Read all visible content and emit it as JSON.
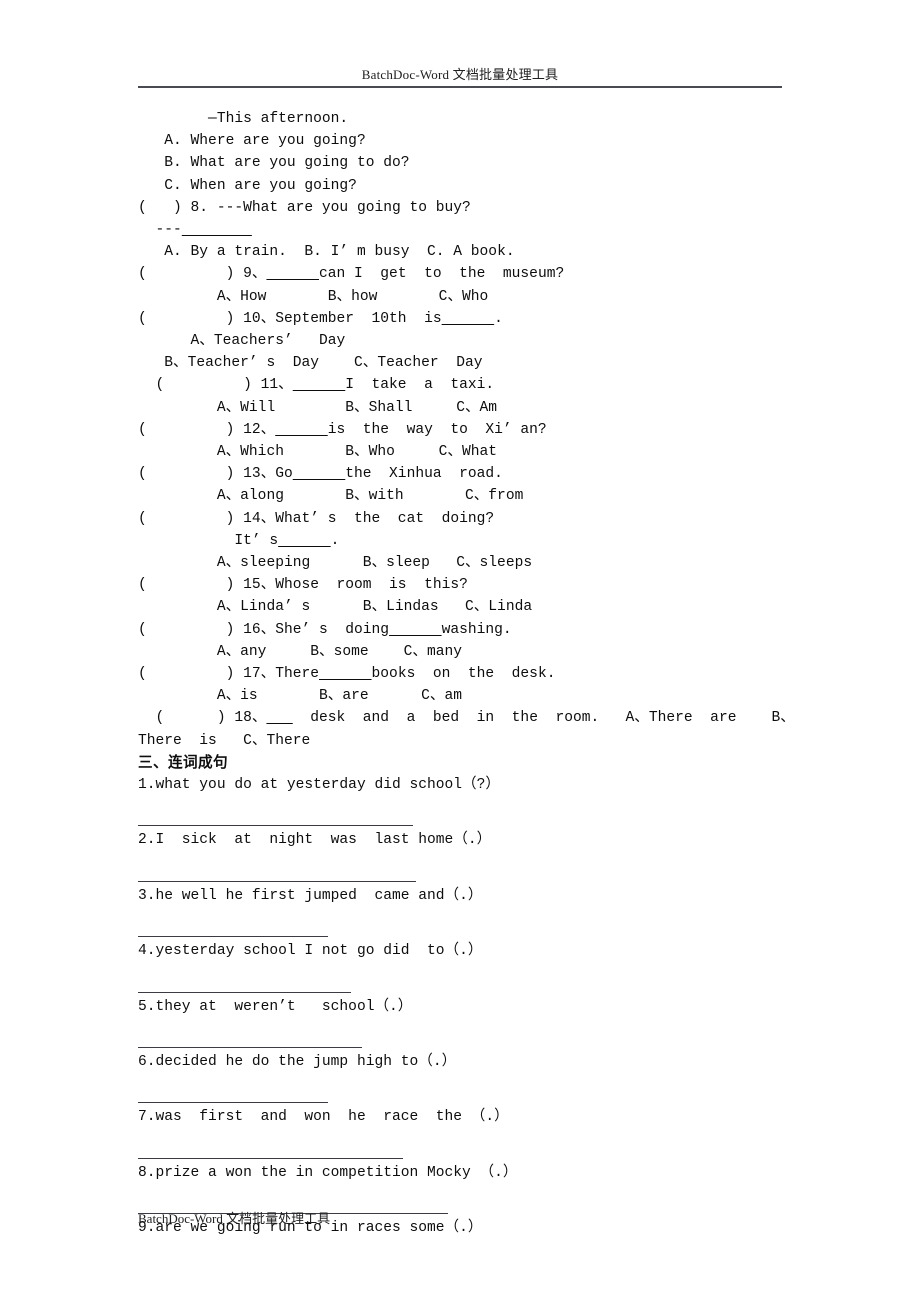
{
  "header": {
    "text": "BatchDoc-Word 文档批量处理工具"
  },
  "footer": {
    "text": "BatchDoc-Word 文档批量处理工具"
  },
  "multiple_choice": {
    "continued_stem": "        —This afternoon.",
    "lines": [
      "   A. Where are you going?",
      "   B. What are you going to do?",
      "   C. When are you going?",
      "(   ) 8. ---What are you going to buy?",
      "  ---________",
      "   A. By a train.  B. I’ m busy  C. A book.",
      "(         ) 9、______can I  get  to  the  museum?",
      "         A、How       B、how       C、Who",
      "(         ) 10、September  10th  is______.",
      "      A、Teachers’   Day",
      "   B、Teacher’ s  Day    C、Teacher  Day",
      "  (         ) 11、______I  take  a  taxi.",
      "         A、Will        B、Shall     C、Am",
      "(         ) 12、______is  the  way  to  Xi’ an?",
      "         A、Which       B、Who     C、What",
      "(         ) 13、Go______the  Xinhua  road.",
      "         A、along       B、with       C、from",
      "(         ) 14、What’ s  the  cat  doing?",
      "           It’ s______.",
      "         A、sleeping      B、sleep   C、sleeps",
      "(         ) 15、Whose  room  is  this?",
      "         A、Linda’ s      B、Lindas   C、Linda",
      "(         ) 16、She’ s  doing______washing.",
      "         A、any     B、some    C、many",
      "(         ) 17、There______books  on  the  desk.",
      "         A、is       B、are      C、am",
      "  (      ) 18、___  desk  and  a  bed  in  the  room.   A、There  are    B、",
      "There  is   C、There"
    ]
  },
  "word_order": {
    "heading": "三、连词成句",
    "items": [
      {
        "number": "1.",
        "text": "what you do at yesterday did school（?）",
        "rule_width": 275
      },
      {
        "number": "2.",
        "text": "I  sick  at  night  was  last home（.）",
        "rule_width": 278
      },
      {
        "number": "3.",
        "text": "he well he first jumped  came and（.）",
        "rule_width": 190
      },
      {
        "number": "4.",
        "text": "yesterday school I not go did  to（.）",
        "rule_width": 213
      },
      {
        "number": "5.",
        "text": "they at  weren’t   school（.）",
        "rule_width": 224
      },
      {
        "number": "6.",
        "text": "decided he do the jump high to（.）",
        "rule_width": 190
      },
      {
        "number": "7.",
        "text": "was  first  and  won  he  race  the （.）",
        "rule_width": 265
      },
      {
        "number": "8.",
        "text": "prize a won the in competition Mocky （.）",
        "rule_width": 310
      },
      {
        "number": "9.",
        "text": "are we going run to in races some（.）",
        "rule_width": 0
      }
    ]
  }
}
